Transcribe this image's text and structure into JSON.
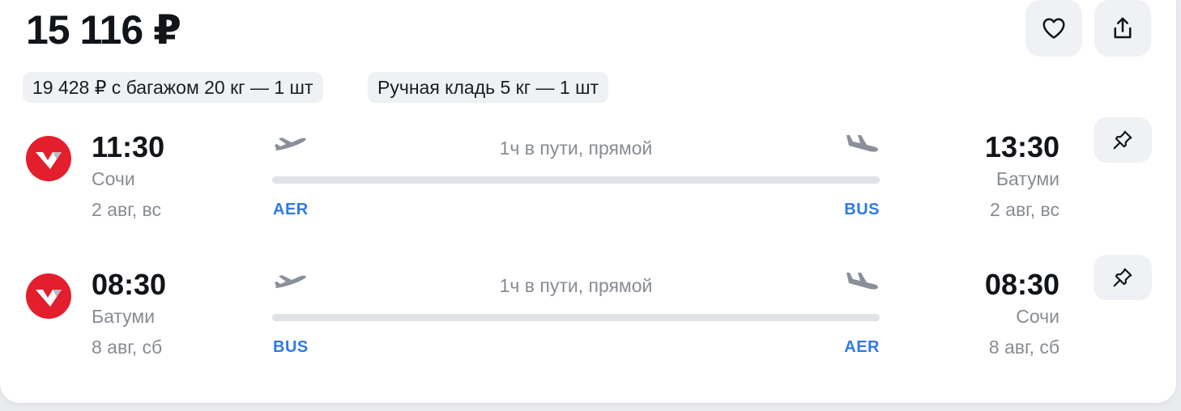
{
  "offer": {
    "price": "15 116 ₽",
    "baggage_chip": "19 428 ₽ с багажом 20 кг — 1 шт",
    "carryon_chip": "Ручная кладь 5 кг — 1 шт"
  },
  "actions": {
    "favorite_icon": "heart-icon",
    "share_icon": "share-icon",
    "pin_icon": "pin-icon"
  },
  "colors": {
    "airline_logo": "#e31e2d",
    "airport_code": "#2f7ae5",
    "muted_text": "#878c94"
  },
  "segments": [
    {
      "departure": {
        "time": "11:30",
        "city": "Сочи",
        "date": "2 авг, вс",
        "code": "AER"
      },
      "arrival": {
        "time": "13:30",
        "city": "Батуми",
        "date": "2 авг, вс",
        "code": "BUS"
      },
      "duration": "1ч в пути, прямой"
    },
    {
      "departure": {
        "time": "08:30",
        "city": "Батуми",
        "date": "8 авг, сб",
        "code": "BUS"
      },
      "arrival": {
        "time": "08:30",
        "city": "Сочи",
        "date": "8 авг, сб",
        "code": "AER"
      },
      "duration": "1ч в пути, прямой"
    }
  ]
}
